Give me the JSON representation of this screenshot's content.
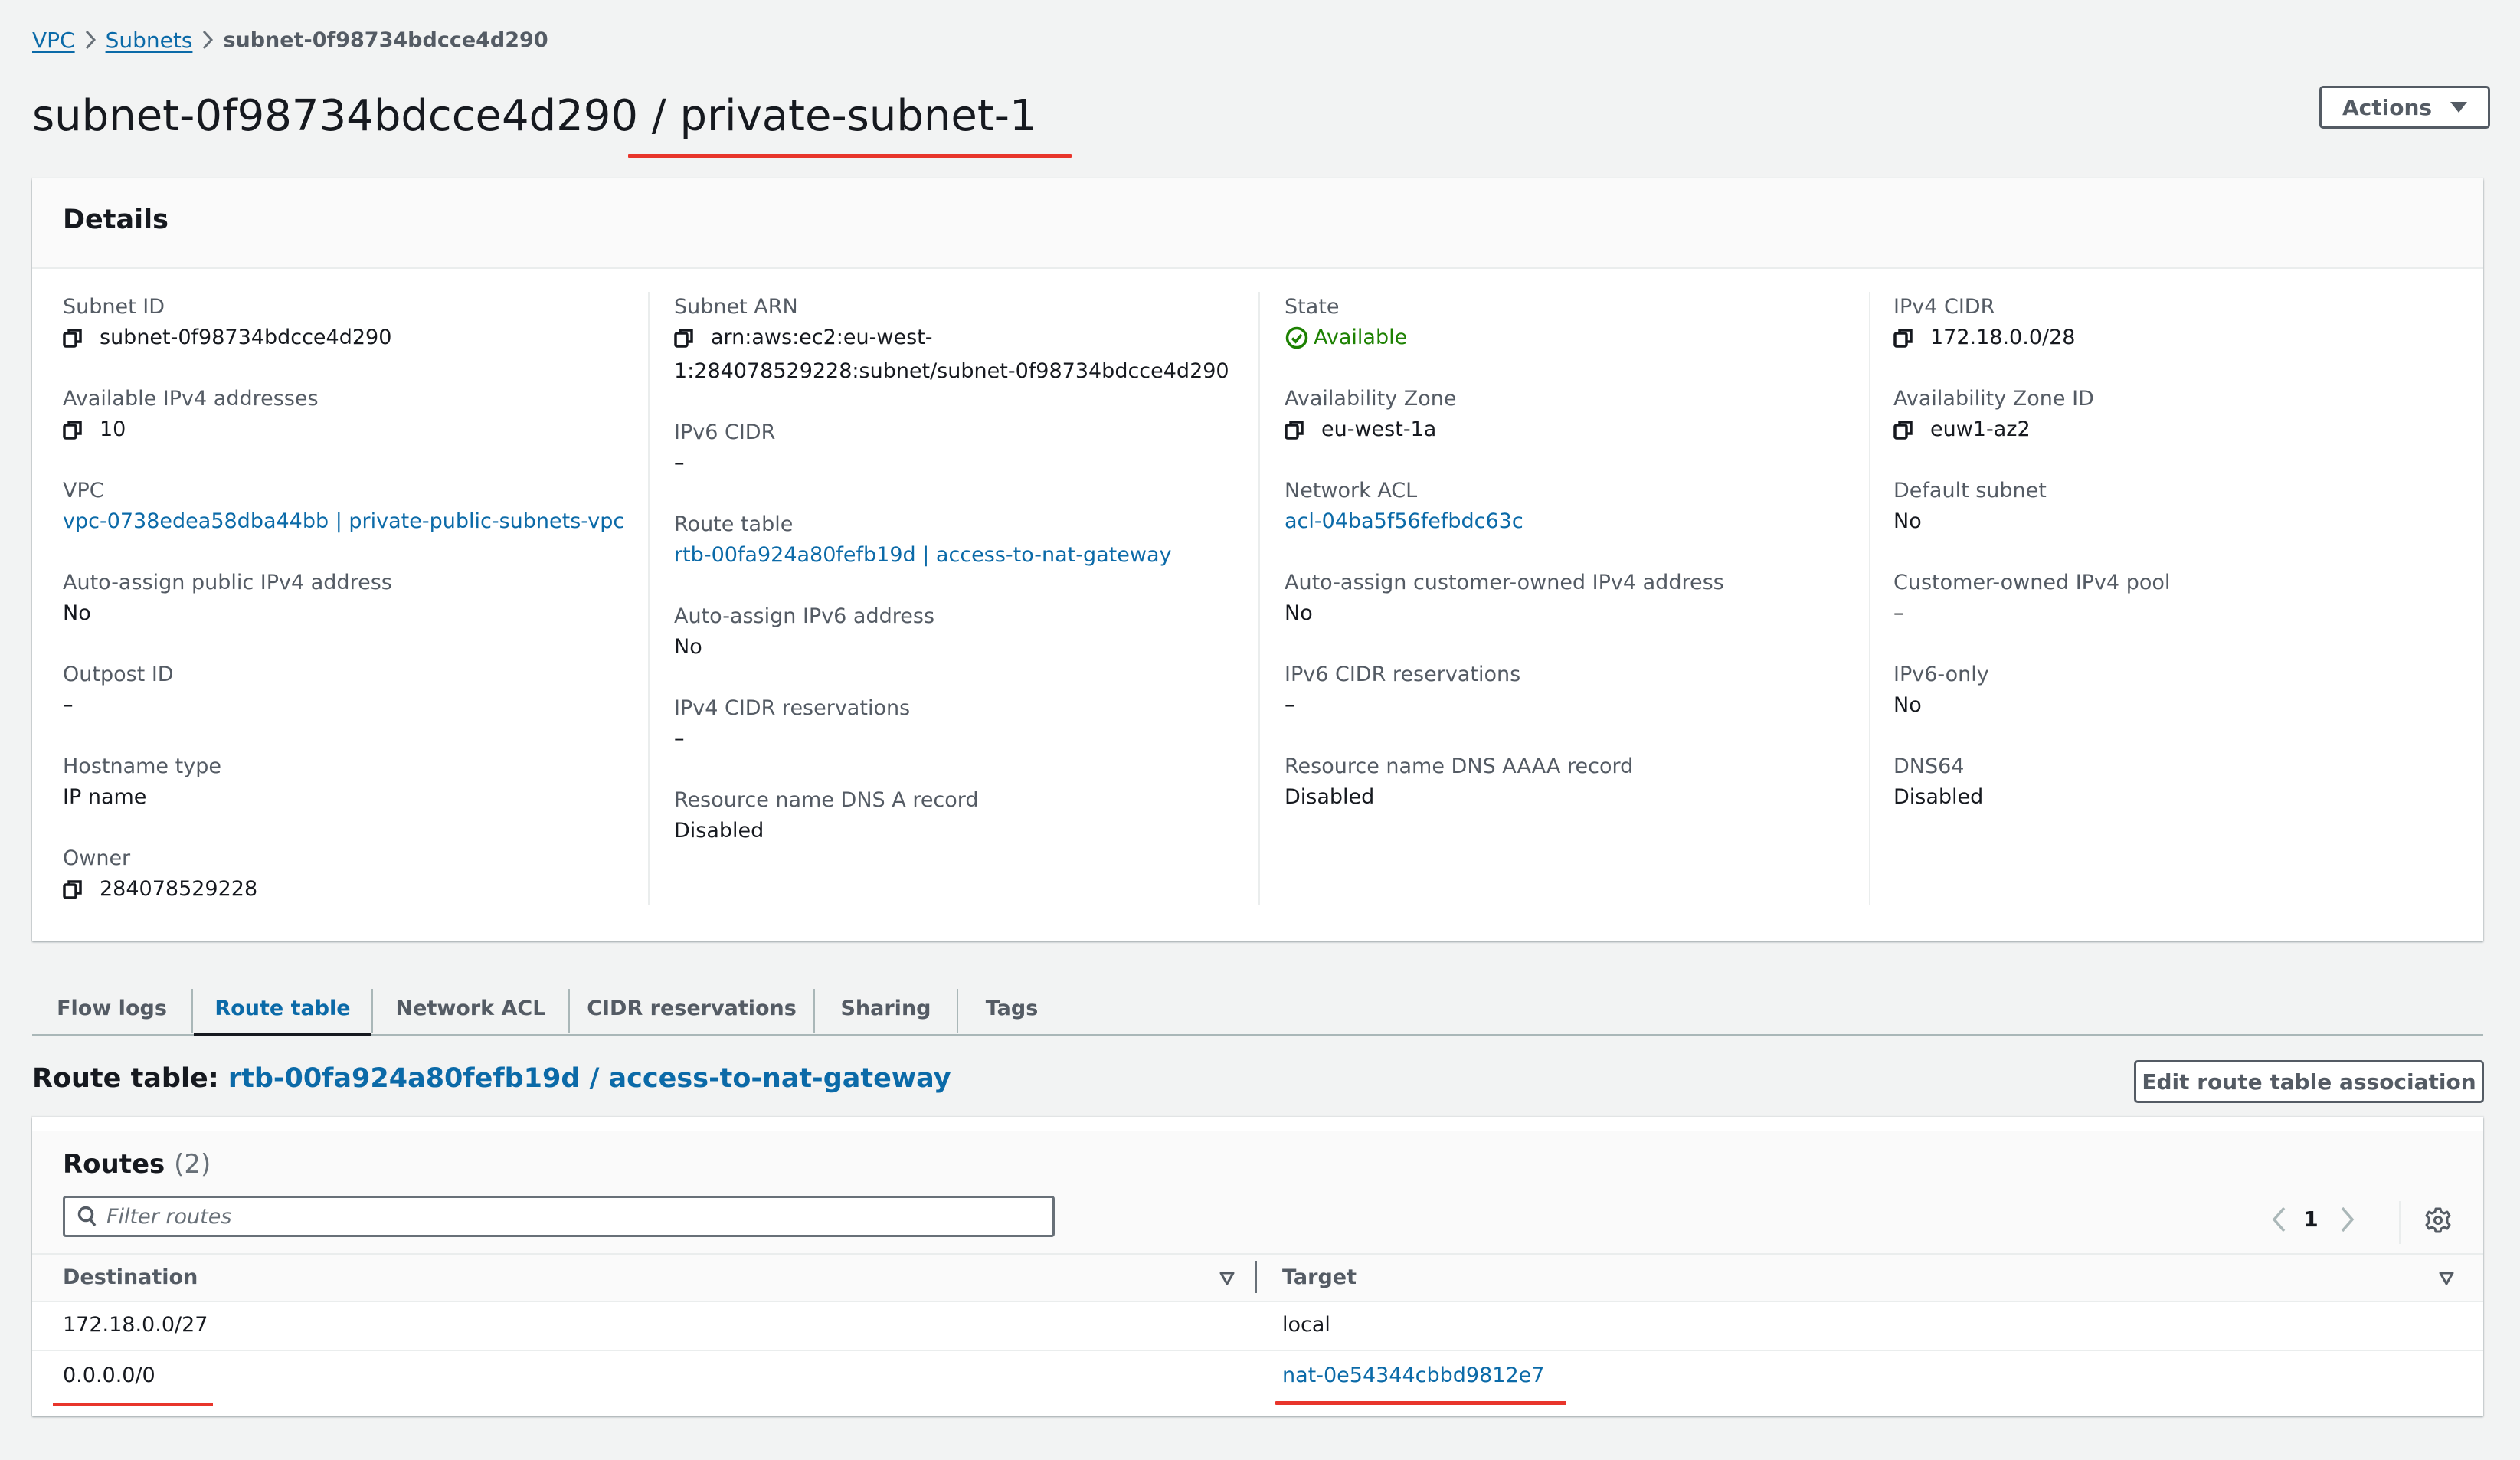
{
  "breadcrumb": {
    "items": [
      {
        "label": "VPC",
        "link": true
      },
      {
        "label": "Subnets",
        "link": true
      },
      {
        "label": "subnet-0f98734bdcce4d290",
        "link": false
      }
    ]
  },
  "header": {
    "title_id": "subnet-0f98734bdcce4d290",
    "title_sep": " / ",
    "title_name": "private-subnet-1",
    "actions_label": "Actions"
  },
  "details": {
    "title": "Details",
    "columns": [
      [
        {
          "label": "Subnet ID",
          "value": "subnet-0f98734bdcce4d290",
          "copy": true
        },
        {
          "label": "Available IPv4 addresses",
          "value": "10",
          "copy": true
        },
        {
          "label": "VPC",
          "value": "vpc-0738edea58dba44bb | private-public-subnets-vpc",
          "link": true
        },
        {
          "label": "Auto-assign public IPv4 address",
          "value": "No"
        },
        {
          "label": "Outpost ID",
          "value": "–"
        },
        {
          "label": "Hostname type",
          "value": "IP name"
        },
        {
          "label": "Owner",
          "value": "284078529228",
          "copy": true
        }
      ],
      [
        {
          "label": "Subnet ARN",
          "value": "arn:aws:ec2:eu-west-1:284078529228:subnet/subnet-0f98734bdcce4d290",
          "value_line1": "arn:aws:ec2:eu-west-",
          "value_line2": "1:284078529228:subnet/subnet-0f98734bdcce4d290",
          "copy": true
        },
        {
          "label": "IPv6 CIDR",
          "value": "–"
        },
        {
          "label": "Route table",
          "value": "rtb-00fa924a80fefb19d | access-to-nat-gateway",
          "link": true
        },
        {
          "label": "Auto-assign IPv6 address",
          "value": "No"
        },
        {
          "label": "IPv4 CIDR reservations",
          "value": "–"
        },
        {
          "label": "Resource name DNS A record",
          "value": "Disabled"
        }
      ],
      [
        {
          "label": "State",
          "value": "Available",
          "status": "success"
        },
        {
          "label": "Availability Zone",
          "value": "eu-west-1a",
          "copy": true
        },
        {
          "label": "Network ACL",
          "value": "acl-04ba5f56fefbdc63c",
          "link": true
        },
        {
          "label": "Auto-assign customer-owned IPv4 address",
          "value": "No"
        },
        {
          "label": "IPv6 CIDR reservations",
          "value": "–"
        },
        {
          "label": "Resource name DNS AAAA record",
          "value": "Disabled"
        }
      ],
      [
        {
          "label": "IPv4 CIDR",
          "value": "172.18.0.0/28",
          "copy": true
        },
        {
          "label": "Availability Zone ID",
          "value": "euw1-az2",
          "copy": true
        },
        {
          "label": "Default subnet",
          "value": "No"
        },
        {
          "label": "Customer-owned IPv4 pool",
          "value": "–"
        },
        {
          "label": "IPv6-only",
          "value": "No"
        },
        {
          "label": "DNS64",
          "value": "Disabled"
        }
      ]
    ]
  },
  "tabs": [
    {
      "label": "Flow logs",
      "active": false
    },
    {
      "label": "Route table",
      "active": true
    },
    {
      "label": "Network ACL",
      "active": false
    },
    {
      "label": "CIDR reservations",
      "active": false
    },
    {
      "label": "Sharing",
      "active": false
    },
    {
      "label": "Tags",
      "active": false
    }
  ],
  "route_table": {
    "heading_label": "Route table: ",
    "heading_link": "rtb-00fa924a80fefb19d / access-to-nat-gateway",
    "edit_button": "Edit route table association",
    "routes_title": "Routes",
    "routes_count": "(2)",
    "filter_placeholder": "Filter routes",
    "filter_value": "",
    "page": "1",
    "columns": [
      "Destination",
      "Target"
    ],
    "rows": [
      {
        "destination": "172.18.0.0/27",
        "target": "local",
        "target_link": false
      },
      {
        "destination": "0.0.0.0/0",
        "target": "nat-0e54344cbbd9812e7",
        "target_link": true
      }
    ]
  },
  "colors": {
    "link": "#0b6aa8",
    "success": "#1d8102",
    "annotation": "#e8352b",
    "background": "#f2f3f3"
  }
}
